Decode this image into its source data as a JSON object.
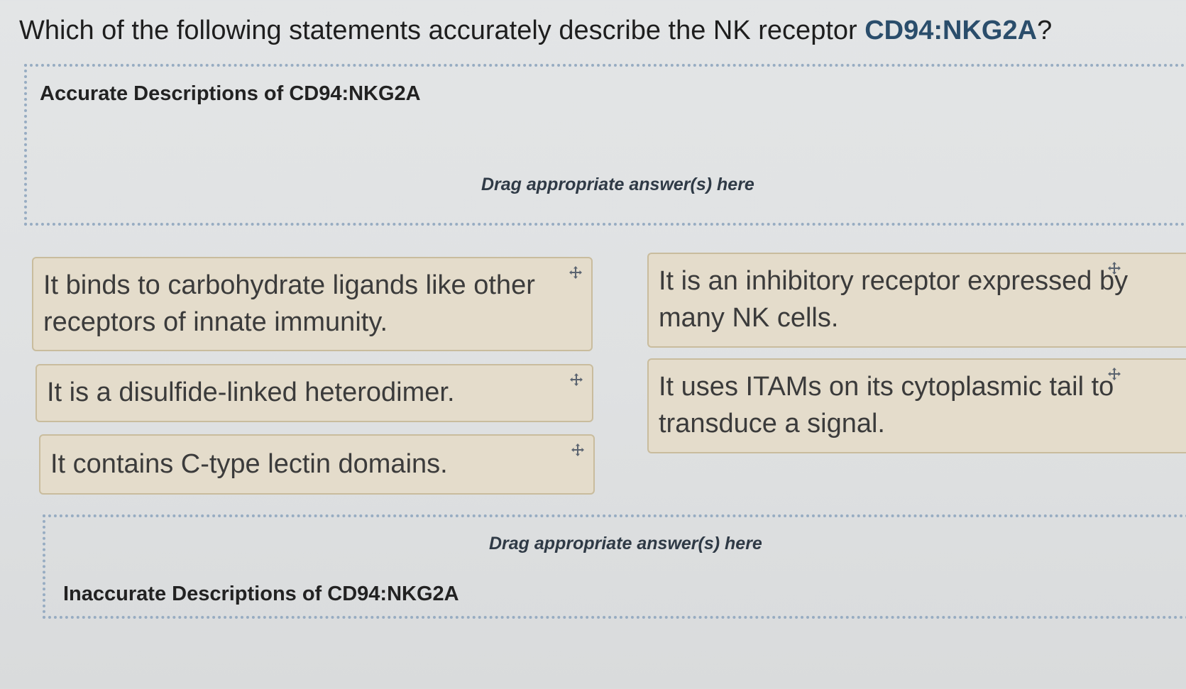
{
  "question": {
    "prefix": "Which of the following statements accurately describe the NK receptor ",
    "highlight": "CD94:NKG2A",
    "suffix": "?"
  },
  "dropzones": {
    "accurate": {
      "title": "Accurate Descriptions of CD94:NKG2A",
      "hint": "Drag appropriate answer(s) here"
    },
    "inaccurate": {
      "title": "Inaccurate Descriptions of CD94:NKG2A",
      "hint": "Drag appropriate answer(s) here"
    }
  },
  "answers": [
    {
      "text": "It binds to carbohydrate ligands like other receptors of innate immunity.",
      "icon": "move-icon"
    },
    {
      "text": "It is a disulfide-linked heterodimer.",
      "icon": "move-icon"
    },
    {
      "text": "It contains C-type lectin domains.",
      "icon": "move-icon"
    },
    {
      "text": "It is an inhibitory receptor expressed by many NK cells.",
      "icon": "move-icon"
    },
    {
      "text": "It uses ITAMs on its cytoplasmic tail to transduce a signal.",
      "icon": "move-icon"
    }
  ],
  "colors": {
    "highlight": "#2a4d6b",
    "answer_bg": "#e4dccb",
    "answer_border": "#c9bc9d",
    "dropzone_border": "#97acc2"
  }
}
